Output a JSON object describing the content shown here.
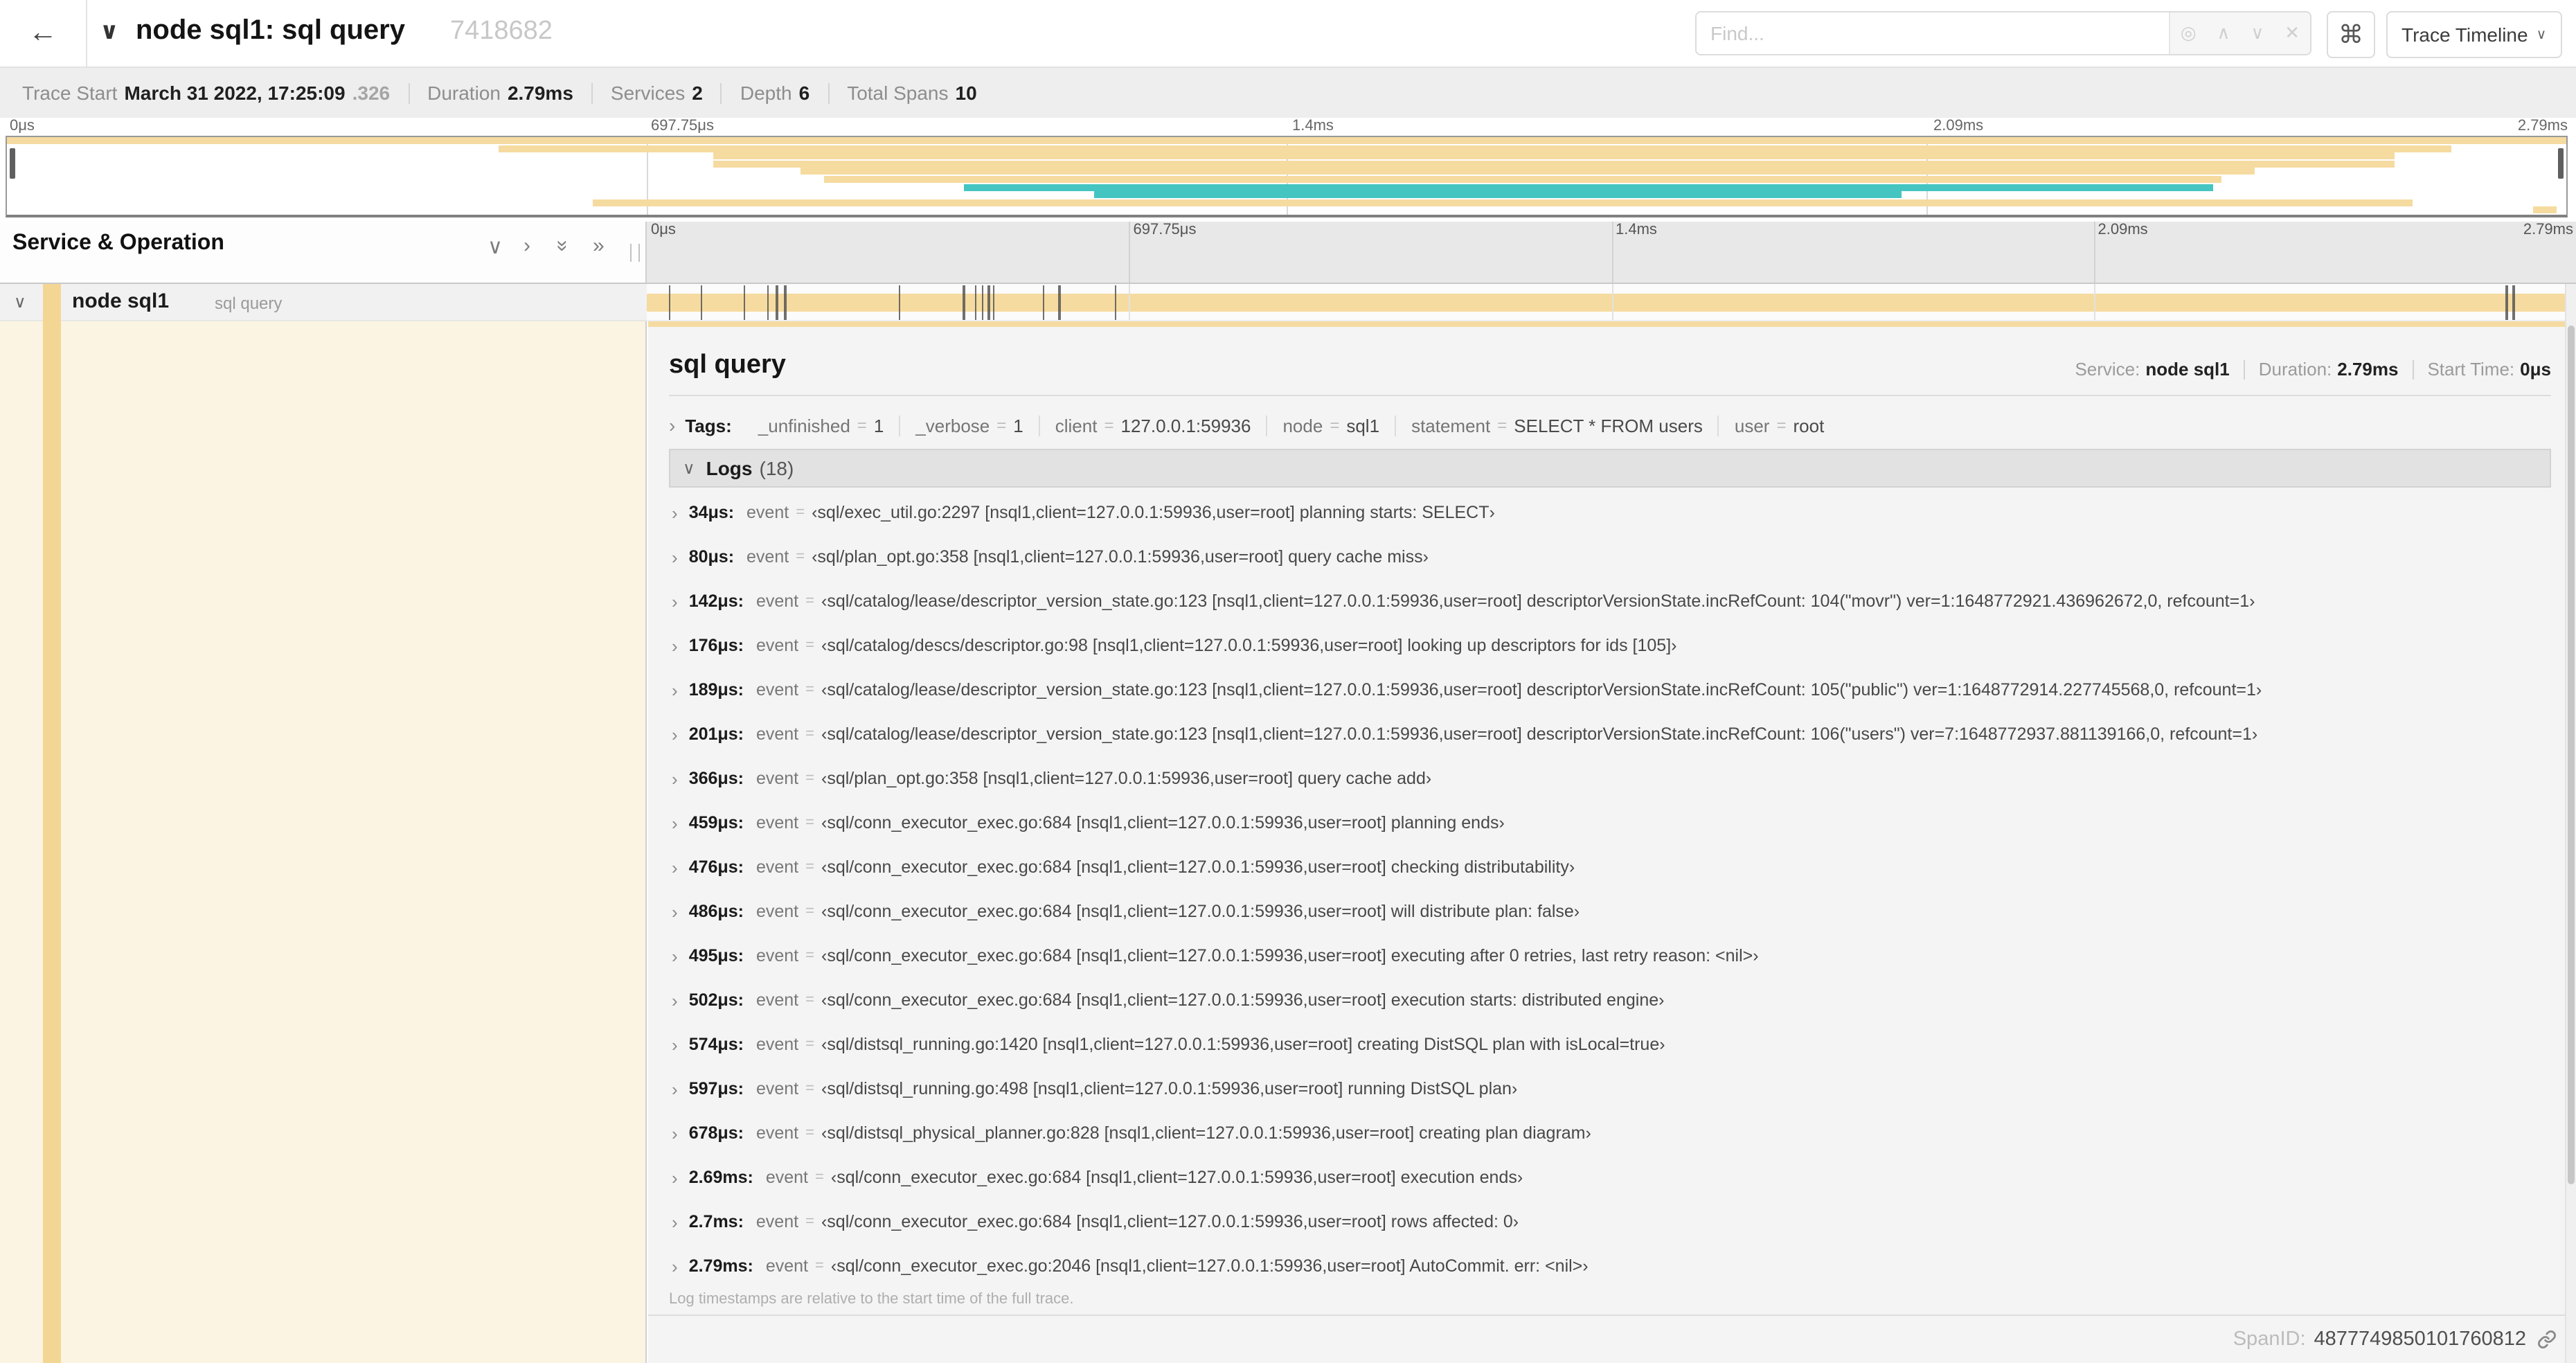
{
  "icons": {
    "back": "←",
    "chevron_down_bold": "∨",
    "chevron_down": "∨",
    "chevron_right": "›",
    "double_chevron": "»",
    "crosshair": "◎",
    "up": "∧",
    "down": "∨",
    "close": "✕",
    "command": "⌘",
    "eq": "="
  },
  "header": {
    "title": "node sql1: sql query",
    "trace_id_short": "7418682",
    "find_placeholder": "Find...",
    "view_selector": "Trace Timeline"
  },
  "stats": {
    "trace_start_label": "Trace Start",
    "trace_start_value": "March 31 2022, 17:25:09",
    "trace_start_frac": ".326",
    "duration_label": "Duration",
    "duration_value": "2.79ms",
    "services_label": "Services",
    "services_value": "2",
    "depth_label": "Depth",
    "depth_value": "6",
    "total_spans_label": "Total Spans",
    "total_spans_value": "10"
  },
  "minimap": {
    "ticks": [
      {
        "label": "0μs",
        "pos": 0
      },
      {
        "label": "697.75μs",
        "pos": 0.25
      },
      {
        "label": "1.4ms",
        "pos": 0.5
      },
      {
        "label": "2.09ms",
        "pos": 0.75
      },
      {
        "label": "2.79ms",
        "pos": 1
      }
    ],
    "spans": [
      {
        "row": 0,
        "start": 0,
        "end": 100,
        "color": "tan"
      },
      {
        "row": 1,
        "start": 19.2,
        "end": 95.5,
        "color": "tan"
      },
      {
        "row": 2,
        "start": 27.6,
        "end": 93.3,
        "color": "tan"
      },
      {
        "row": 3,
        "start": 27.6,
        "end": 93.3,
        "color": "tan"
      },
      {
        "row": 4,
        "start": 31.0,
        "end": 87.8,
        "color": "tan"
      },
      {
        "row": 5,
        "start": 31.9,
        "end": 86.5,
        "color": "tan"
      },
      {
        "row": 6,
        "start": 37.4,
        "end": 86.2,
        "color": "teal"
      },
      {
        "row": 7,
        "start": 42.5,
        "end": 74.0,
        "color": "teal"
      },
      {
        "row": 8,
        "start": 22.9,
        "end": 94.0,
        "color": "tan"
      },
      {
        "row": 9,
        "start": 98.7,
        "end": 99.6,
        "color": "tan"
      }
    ]
  },
  "timeline": {
    "header_label": "Service & Operation",
    "ticks": [
      {
        "label": "0μs",
        "pos": 0
      },
      {
        "label": "697.75μs",
        "pos": 0.25
      },
      {
        "label": "1.4ms",
        "pos": 0.5
      },
      {
        "label": "2.09ms",
        "pos": 0.75
      },
      {
        "label": "2.79ms",
        "pos": 1
      }
    ]
  },
  "span_row": {
    "service": "node sql1",
    "operation": "sql query",
    "duration_us": 2790,
    "log_marker_times_us": [
      34,
      80,
      142,
      176,
      189,
      201,
      366,
      459,
      476,
      486,
      495,
      502,
      574,
      597,
      678,
      2690,
      2700,
      2790
    ]
  },
  "detail": {
    "operation": "sql query",
    "service_label": "Service:",
    "service_value": "node sql1",
    "duration_label": "Duration:",
    "duration_value": "2.79ms",
    "start_label": "Start Time:",
    "start_value": "0μs",
    "tags_label": "Tags:",
    "tags": [
      {
        "key": "_unfinished",
        "value": "1"
      },
      {
        "key": "_verbose",
        "value": "1"
      },
      {
        "key": "client",
        "value": "127.0.0.1:59936"
      },
      {
        "key": "node",
        "value": "sql1"
      },
      {
        "key": "statement",
        "value": "SELECT * FROM users"
      },
      {
        "key": "user",
        "value": "root"
      }
    ],
    "logs_label": "Logs",
    "logs_count": "(18)",
    "logs": [
      {
        "time": "34μs:",
        "t_us": 34,
        "key": "event",
        "value": "‹sql/exec_util.go:2297 [nsql1,client=127.0.0.1:59936,user=root] planning starts: SELECT›"
      },
      {
        "time": "80μs:",
        "t_us": 80,
        "key": "event",
        "value": "‹sql/plan_opt.go:358 [nsql1,client=127.0.0.1:59936,user=root] query cache miss›"
      },
      {
        "time": "142μs:",
        "t_us": 142,
        "key": "event",
        "value": "‹sql/catalog/lease/descriptor_version_state.go:123 [nsql1,client=127.0.0.1:59936,user=root] descriptorVersionState.incRefCount: 104(\"movr\") ver=1:1648772921.436962672,0, refcount=1›"
      },
      {
        "time": "176μs:",
        "t_us": 176,
        "key": "event",
        "value": "‹sql/catalog/descs/descriptor.go:98 [nsql1,client=127.0.0.1:59936,user=root] looking up descriptors for ids [105]›"
      },
      {
        "time": "189μs:",
        "t_us": 189,
        "key": "event",
        "value": "‹sql/catalog/lease/descriptor_version_state.go:123 [nsql1,client=127.0.0.1:59936,user=root] descriptorVersionState.incRefCount: 105(\"public\") ver=1:1648772914.227745568,0, refcount=1›"
      },
      {
        "time": "201μs:",
        "t_us": 201,
        "key": "event",
        "value": "‹sql/catalog/lease/descriptor_version_state.go:123 [nsql1,client=127.0.0.1:59936,user=root] descriptorVersionState.incRefCount: 106(\"users\") ver=7:1648772937.881139166,0, refcount=1›"
      },
      {
        "time": "366μs:",
        "t_us": 366,
        "key": "event",
        "value": "‹sql/plan_opt.go:358 [nsql1,client=127.0.0.1:59936,user=root] query cache add›"
      },
      {
        "time": "459μs:",
        "t_us": 459,
        "key": "event",
        "value": "‹sql/conn_executor_exec.go:684 [nsql1,client=127.0.0.1:59936,user=root] planning ends›"
      },
      {
        "time": "476μs:",
        "t_us": 476,
        "key": "event",
        "value": "‹sql/conn_executor_exec.go:684 [nsql1,client=127.0.0.1:59936,user=root] checking distributability›"
      },
      {
        "time": "486μs:",
        "t_us": 486,
        "key": "event",
        "value": "‹sql/conn_executor_exec.go:684 [nsql1,client=127.0.0.1:59936,user=root] will distribute plan: false›"
      },
      {
        "time": "495μs:",
        "t_us": 495,
        "key": "event",
        "value": "‹sql/conn_executor_exec.go:684 [nsql1,client=127.0.0.1:59936,user=root] executing after 0 retries, last retry reason: <nil>›"
      },
      {
        "time": "502μs:",
        "t_us": 502,
        "key": "event",
        "value": "‹sql/conn_executor_exec.go:684 [nsql1,client=127.0.0.1:59936,user=root] execution starts: distributed engine›"
      },
      {
        "time": "574μs:",
        "t_us": 574,
        "key": "event",
        "value": "‹sql/distsql_running.go:1420 [nsql1,client=127.0.0.1:59936,user=root] creating DistSQL plan with isLocal=true›"
      },
      {
        "time": "597μs:",
        "t_us": 597,
        "key": "event",
        "value": "‹sql/distsql_running.go:498 [nsql1,client=127.0.0.1:59936,user=root] running DistSQL plan›"
      },
      {
        "time": "678μs:",
        "t_us": 678,
        "key": "event",
        "value": "‹sql/distsql_physical_planner.go:828 [nsql1,client=127.0.0.1:59936,user=root] creating plan diagram›"
      },
      {
        "time": "2.69ms:",
        "t_us": 2690,
        "key": "event",
        "value": "‹sql/conn_executor_exec.go:684 [nsql1,client=127.0.0.1:59936,user=root] execution ends›"
      },
      {
        "time": "2.7ms:",
        "t_us": 2700,
        "key": "event",
        "value": "‹sql/conn_executor_exec.go:684 [nsql1,client=127.0.0.1:59936,user=root] rows affected: 0›"
      },
      {
        "time": "2.79ms:",
        "t_us": 2790,
        "key": "event",
        "value": "‹sql/conn_executor_exec.go:2046 [nsql1,client=127.0.0.1:59936,user=root] AutoCommit. err: <nil>›"
      }
    ],
    "footer": "Log timestamps are relative to the start time of the full trace.",
    "span_id_label": "SpanID:",
    "span_id": "4877749850101760812"
  },
  "colors": {
    "tan": "#F5DBA0",
    "teal": "#45C5C1",
    "cream": "#FBF4E2",
    "stripe": "#F3D693"
  }
}
